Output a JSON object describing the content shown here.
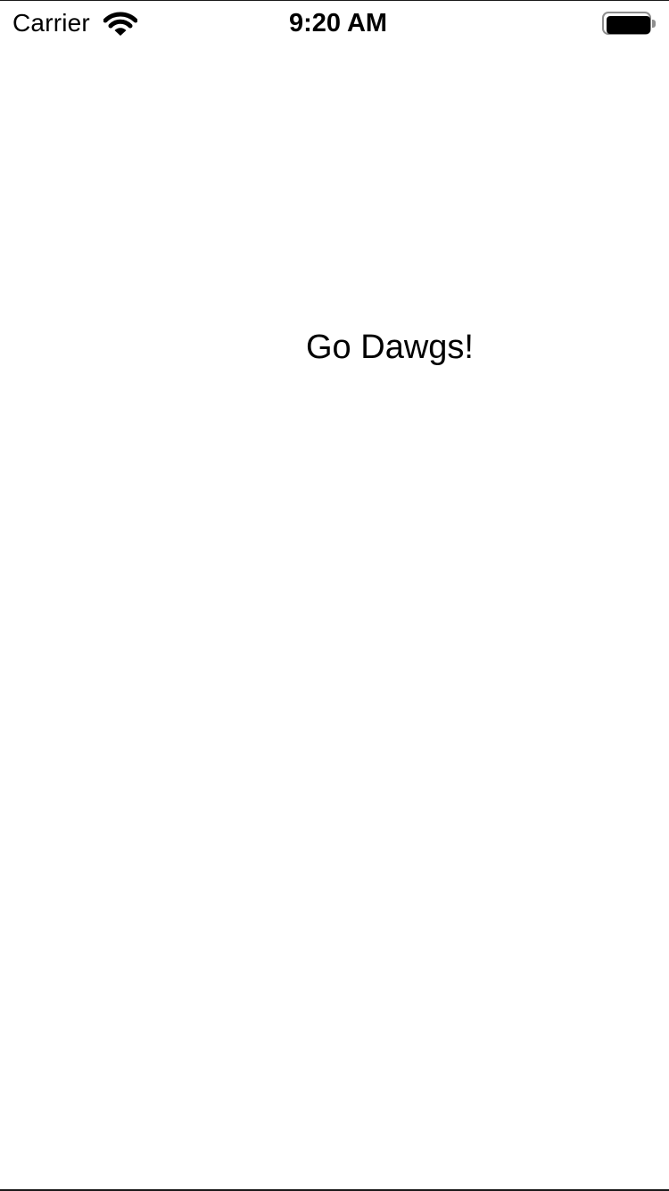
{
  "status_bar": {
    "carrier": "Carrier",
    "time": "9:20 AM",
    "wifi_icon": "wifi-icon",
    "battery_icon": "battery-icon",
    "battery_level": 1.0
  },
  "main": {
    "label": "Go Dawgs!"
  },
  "colors": {
    "background": "#ffffff",
    "text": "#000000",
    "battery_outline": "#8e8e8e"
  }
}
